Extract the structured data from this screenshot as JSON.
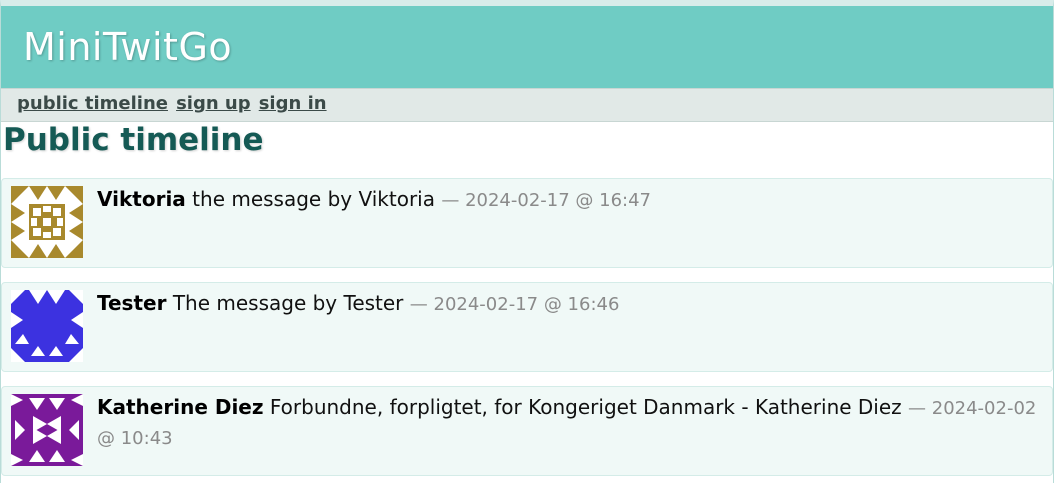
{
  "app": {
    "title": "MiniTwitGo"
  },
  "nav": {
    "public_timeline": "public timeline",
    "sign_up": "sign up",
    "sign_in": "sign in"
  },
  "page": {
    "heading": "Public timeline"
  },
  "messages": [
    {
      "author": "Viktoria",
      "text": "the message by Viktoria",
      "meta": "— 2024-02-17 @ 16:47",
      "avatar_color": "#a8892d"
    },
    {
      "author": "Tester",
      "text": "The message by Tester",
      "meta": "— 2024-02-17 @ 16:46",
      "avatar_color": "#3c32e0"
    },
    {
      "author": "Katherine Diez",
      "text": "Forbundne, forpligtet, for Kongeriget Danmark - Katherine Diez",
      "meta": "— 2024-02-02 @ 10:43",
      "avatar_color": "#7a1a9a"
    }
  ],
  "colors": {
    "header_bg": "#6fccc4",
    "nav_bg": "#e1e9e7",
    "heading": "#155a55",
    "message_bg": "#f0f9f7"
  }
}
